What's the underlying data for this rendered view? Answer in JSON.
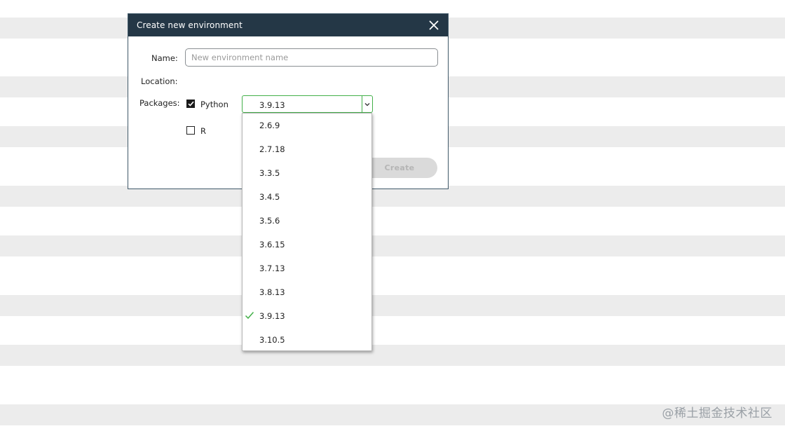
{
  "dialog": {
    "title": "Create new environment",
    "name_label": "Name:",
    "name_placeholder": "New environment name",
    "name_value": "",
    "location_label": "Location:",
    "packages_label": "Packages:",
    "python_label": "Python",
    "python_checked": true,
    "r_label": "R",
    "r_checked": false,
    "python_version_selected": "3.9.13",
    "create_label": "Create",
    "create_enabled": false
  },
  "dropdown": {
    "options": [
      "2.6.9",
      "2.7.18",
      "3.3.5",
      "3.4.5",
      "3.5.6",
      "3.6.15",
      "3.7.13",
      "3.8.13",
      "3.9.13",
      "3.10.5"
    ],
    "selected": "3.9.13"
  },
  "watermark": "@稀土掘金技术社区",
  "colors": {
    "titlebar": "#243746",
    "accent_green": "#43b049",
    "stripe": "#ececec",
    "disabled_button": "#dadada"
  },
  "icons": {
    "close": "close-icon",
    "chevron": "chevron-down-icon",
    "checkmark": "checkmark-icon"
  }
}
